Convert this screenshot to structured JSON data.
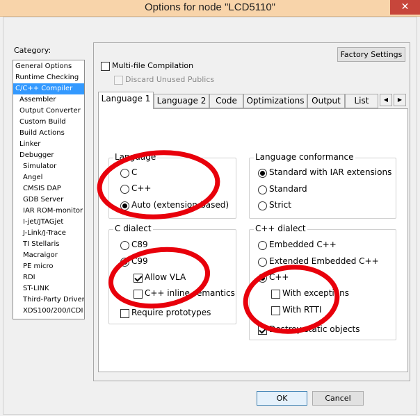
{
  "window": {
    "title": "Options for node \"LCD5110\"",
    "close_glyph": "✕",
    "titlebar_color": "#f8d4aa"
  },
  "category": {
    "label": "Category:",
    "items": [
      "General Options",
      "Runtime Checking",
      "C/C++ Compiler",
      "Assembler",
      "Output Converter",
      "Custom Build",
      "Build Actions",
      "Linker",
      "Debugger",
      "Simulator",
      "Angel",
      "CMSIS DAP",
      "GDB Server",
      "IAR ROM-monitor",
      "I-jet/JTAGjet",
      "J-Link/J-Trace",
      "TI Stellaris",
      "Macraigor",
      "PE micro",
      "RDI",
      "ST-LINK",
      "Third-Party Driver",
      "XDS100/200/ICDI"
    ],
    "selected": "C/C++ Compiler"
  },
  "toolbar": {
    "factory_settings": "Factory Settings",
    "multi_file": "Multi-file Compilation",
    "discard_unused": "Discard Unused Publics"
  },
  "tabs": [
    "Language 1",
    "Language 2",
    "Code",
    "Optimizations",
    "Output",
    "List"
  ],
  "tab_scroll": {
    "left": "◀",
    "right": "▶"
  },
  "language_group": {
    "title": "Language",
    "options": [
      "C",
      "C++",
      "Auto (extension-based)"
    ],
    "selected": "Auto (extension-based)"
  },
  "conformance_group": {
    "title": "Language conformance",
    "options": [
      "Standard with IAR extensions",
      "Standard",
      "Strict"
    ],
    "selected": "Standard with IAR extensions"
  },
  "c_dialect_group": {
    "title": "C dialect",
    "c89": "C89",
    "c99": "C99",
    "allow_vla": "Allow VLA",
    "cpp_inline": "C++ inline semantics",
    "require_prototypes": "Require prototypes",
    "selected": "C99"
  },
  "cpp_dialect_group": {
    "title": "C++ dialect",
    "embedded_cpp": "Embedded C++",
    "extended_embedded_cpp": "Extended Embedded C++",
    "cpp": "C++",
    "with_exceptions": "With exceptions",
    "with_rtti": "With RTTI",
    "destroy_static": "Destroy static objects",
    "selected": "C++"
  },
  "buttons": {
    "ok": "OK",
    "cancel": "Cancel"
  },
  "annotation_color": "#e8000b"
}
